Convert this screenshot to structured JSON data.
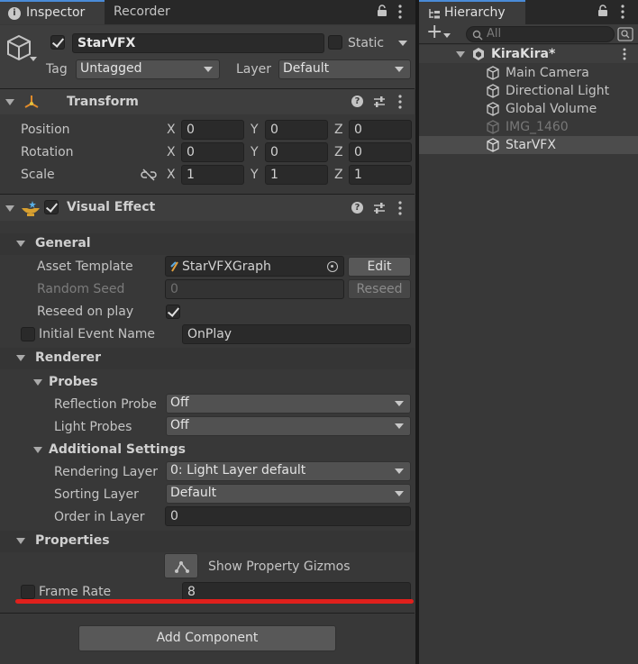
{
  "tabs": {
    "inspector": "Inspector",
    "recorder": "Recorder",
    "hierarchy": "Hierarchy"
  },
  "object": {
    "name": "StarVFX",
    "static_label": "Static",
    "tag_label": "Tag",
    "tag_value": "Untagged",
    "layer_label": "Layer",
    "layer_value": "Default"
  },
  "transform": {
    "title": "Transform",
    "rows": [
      {
        "label": "Position",
        "x": "0",
        "y": "0",
        "z": "0"
      },
      {
        "label": "Rotation",
        "x": "0",
        "y": "0",
        "z": "0"
      },
      {
        "label": "Scale",
        "x": "1",
        "y": "1",
        "z": "1"
      }
    ],
    "axis": {
      "x": "X",
      "y": "Y",
      "z": "Z"
    }
  },
  "visual_effect": {
    "title": "Visual Effect",
    "general": {
      "title": "General",
      "asset_template_label": "Asset Template",
      "asset_template_value": "StarVFXGraph",
      "edit_label": "Edit",
      "random_seed_label": "Random Seed",
      "random_seed_value": "0",
      "reseed_label": "Reseed",
      "reseed_on_play_label": "Reseed on play",
      "initial_event_label": "Initial Event Name",
      "initial_event_value": "OnPlay"
    },
    "renderer": {
      "title": "Renderer",
      "probes_title": "Probes",
      "reflection_probe_label": "Reflection Probe",
      "reflection_probe_value": "Off",
      "light_probes_label": "Light Probes",
      "light_probes_value": "Off",
      "additional_title": "Additional Settings",
      "rendering_layer_label": "Rendering Layer",
      "rendering_layer_value": "0: Light Layer default",
      "sorting_layer_label": "Sorting Layer",
      "sorting_layer_value": "Default",
      "order_label": "Order in Layer",
      "order_value": "0"
    },
    "properties": {
      "title": "Properties",
      "gizmos_label": "Show Property Gizmos",
      "frame_rate_label": "Frame Rate",
      "frame_rate_value": "8"
    }
  },
  "add_component_label": "Add Component",
  "hierarchy": {
    "search_placeholder": "All",
    "scene_name": "KiraKira*",
    "items": [
      {
        "label": "Main Camera"
      },
      {
        "label": "Directional Light"
      },
      {
        "label": "Global Volume"
      },
      {
        "label": "IMG_1460"
      },
      {
        "label": "StarVFX"
      }
    ]
  },
  "colors": {
    "highlight_underline": "#e0201c",
    "panel_bg": "#383838",
    "section_bg": "#353535"
  }
}
